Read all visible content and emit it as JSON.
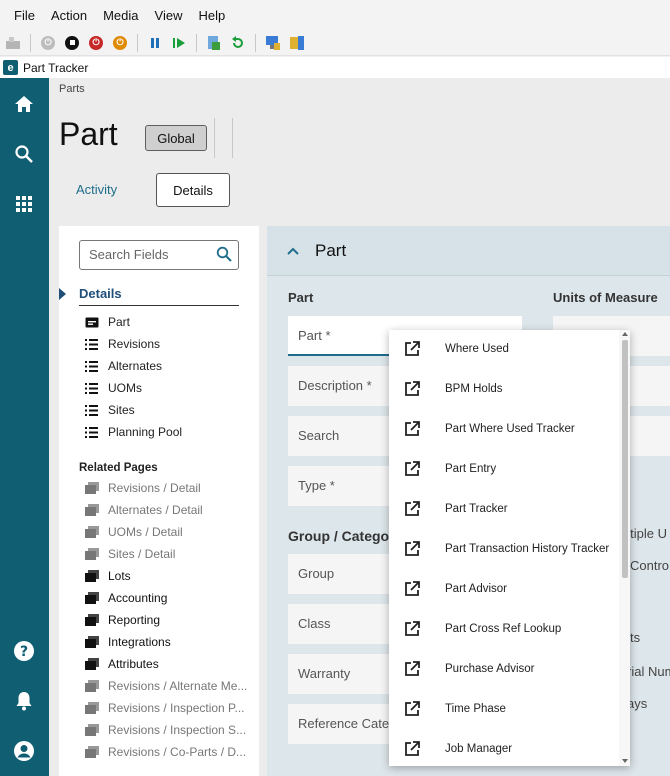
{
  "menubar": {
    "items": [
      "File",
      "Action",
      "Media",
      "View",
      "Help"
    ]
  },
  "toolbar": {
    "icons": [
      "ctrl-alt-del-icon",
      "power-icon",
      "stop-icon",
      "shutdown-icon",
      "power-orange-icon",
      "pause-icon",
      "play-icon",
      "save-state-icon",
      "revert-icon",
      "network-icon",
      "settings-icon"
    ]
  },
  "window": {
    "title": "Part Tracker",
    "logo": "e"
  },
  "colors": {
    "rail": "#0f5e72",
    "accent": "#1f6d8a",
    "heading": "#1f4e79"
  },
  "breadcrumb": "Parts",
  "page": {
    "title": "Part",
    "global_label": "Global"
  },
  "tabs": {
    "activity": "Activity",
    "details": "Details"
  },
  "nav": {
    "search_placeholder": "Search Fields",
    "details_heading": "Details",
    "sections": [
      "Part",
      "Revisions",
      "Alternates",
      "UOMs",
      "Sites",
      "Planning Pool"
    ],
    "related_heading": "Related Pages",
    "related": [
      "Revisions / Detail",
      "Alternates / Detail",
      "UOMs / Detail",
      "Sites / Detail",
      "Lots",
      "Accounting",
      "Reporting",
      "Integrations",
      "Attributes",
      "Revisions / Alternate Me...",
      "Revisions / Inspection P...",
      "Revisions / Inspection S...",
      "Revisions / Co-Parts / D..."
    ]
  },
  "form": {
    "header": "Part",
    "part_group_title": "Part",
    "fields": [
      "Part *",
      "Description *",
      "Search",
      "Type *"
    ],
    "group_title": "Group / Category",
    "group_fields": [
      "Group",
      "Class",
      "Warranty",
      "Reference Categ"
    ],
    "uom_title": "Units of Measure",
    "right_fragments": [
      "ultiple U",
      "Contro",
      "ts",
      "rial Num",
      "ays"
    ]
  },
  "dropdown": {
    "items": [
      "Where Used",
      "BPM Holds",
      "Part Where Used Tracker",
      "Part Entry",
      "Part Tracker",
      "Part Transaction History Tracker",
      "Part Advisor",
      "Part Cross Ref Lookup",
      "Purchase Advisor",
      "Time Phase",
      "Job Manager"
    ]
  }
}
